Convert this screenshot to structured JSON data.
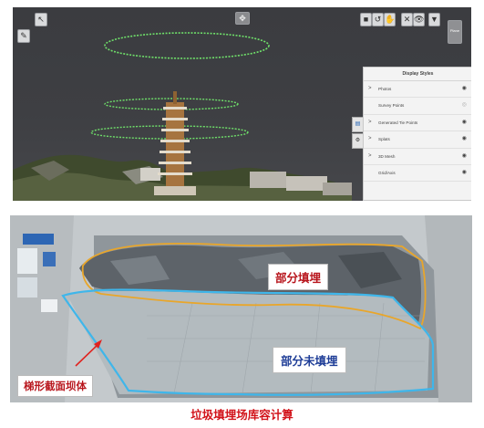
{
  "viewer": {
    "toolbar_right": [
      "■",
      "↺",
      "✋",
      "✕",
      "👁",
      "▼"
    ],
    "toolbar_extra": "Plane",
    "display_styles": {
      "title": "Display Styles",
      "items": [
        {
          "label": "Photos",
          "has_arrow": true,
          "visible": true
        },
        {
          "label": "Survey Points",
          "has_arrow": false,
          "visible": false
        },
        {
          "label": "Generated Tie Points",
          "has_arrow": true,
          "visible": true
        },
        {
          "label": "Splats",
          "has_arrow": true,
          "visible": true
        },
        {
          "label": "3D Mesh",
          "has_arrow": true,
          "visible": true
        },
        {
          "label": "Grid/Axis",
          "has_arrow": false,
          "visible": true
        }
      ]
    },
    "colors": {
      "background": "#3d3e42",
      "orbit": "#6fe06a",
      "panel": "#f3f3f3"
    }
  },
  "landfill": {
    "label_filled": "部分填埋",
    "label_unfilled": "部分未填埋",
    "label_dam": "梯形截面坝体",
    "colors": {
      "filled_boundary": "#e9a62a",
      "unfilled_boundary": "#3fb6ea",
      "label_text_red": "#b8161d",
      "label_text_blue": "#1e3d97",
      "arrow": "#e0231f"
    }
  },
  "caption": "垃圾填埋场库容计算"
}
